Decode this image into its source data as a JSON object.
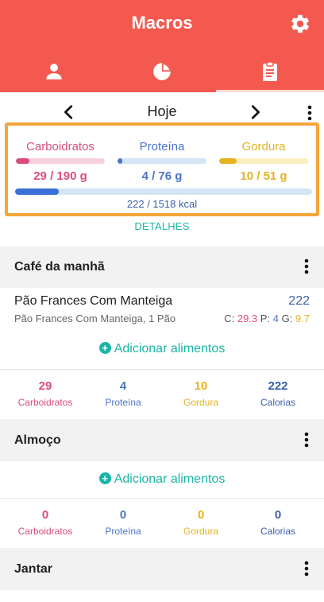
{
  "app": {
    "title": "Macros"
  },
  "day": {
    "label": "Hoje"
  },
  "summary": {
    "carbs": {
      "label": "Carboidratos",
      "value": "29 / 190 g",
      "fraction": 0.153
    },
    "protein": {
      "label": "Proteína",
      "value": "4 / 76 g",
      "fraction": 0.053
    },
    "fat": {
      "label": "Gordura",
      "value": "10 / 51 g",
      "fraction": 0.196
    },
    "calories": {
      "value": "222 / 1518 kcal",
      "fraction": 0.146
    },
    "details_label": "DETALHES"
  },
  "meals": [
    {
      "title": "Café da manhã",
      "food": {
        "name": "Pão Frances Com Manteiga",
        "description": "Pão Frances Com Manteiga, 1 Pão",
        "calories": "222",
        "c_label": "C:",
        "c_value": "29.3",
        "p_label": "P:",
        "p_value": "4",
        "g_label": "G:",
        "g_value": "9.7"
      },
      "add_label": "Adicionar alimentos",
      "totals": {
        "carbs": "29",
        "protein": "4",
        "fat": "10",
        "calories": "222"
      }
    },
    {
      "title": "Almoço",
      "add_label": "Adicionar alimentos",
      "totals": {
        "carbs": "0",
        "protein": "0",
        "fat": "0",
        "calories": "0"
      }
    },
    {
      "title": "Jantar"
    }
  ],
  "labels": {
    "carbs": "Carboidratos",
    "protein": "Proteína",
    "fat": "Gordura",
    "calories": "Calorias"
  },
  "colors": {
    "header": "#f4594f",
    "carbs": "#d94d7a",
    "protein": "#4a74c9",
    "fat": "#e6b21f",
    "calories": "#3a5fa8",
    "accent": "#1bb5a7",
    "highlight_border": "#f5a53a"
  },
  "icons": {
    "settings": "gear-icon",
    "profile": "person-icon",
    "stats": "pie-chart-icon",
    "diary": "clipboard-icon"
  }
}
